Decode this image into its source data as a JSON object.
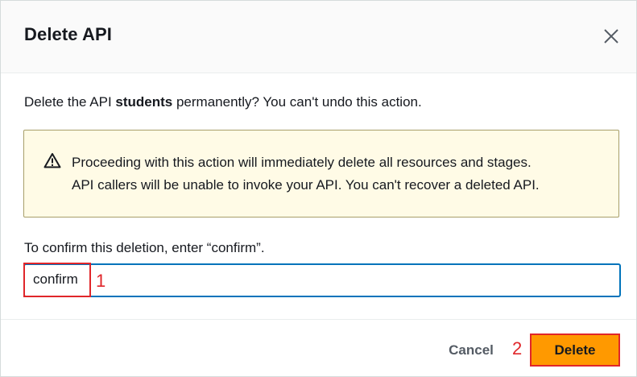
{
  "dialog": {
    "title": "Delete API",
    "close_icon": "close-icon"
  },
  "message": {
    "prefix": "Delete the API ",
    "api_name": "students",
    "suffix": " permanently? You can't undo this action."
  },
  "alert": {
    "icon": "warning-icon",
    "line1": "Proceeding with this action will immediately delete all resources and stages.",
    "line2": "API callers will be unable to invoke your API. You can't recover a deleted API."
  },
  "confirm": {
    "label": "To confirm this deletion, enter “confirm”.",
    "value": "confirm"
  },
  "annotations": {
    "step1": "1",
    "step2": "2",
    "color": "#e0262a"
  },
  "footer": {
    "cancel_label": "Cancel",
    "delete_label": "Delete"
  },
  "colors": {
    "primary_button": "#ff9900",
    "input_focus_border": "#0073bb",
    "alert_background": "#fffbe6"
  }
}
